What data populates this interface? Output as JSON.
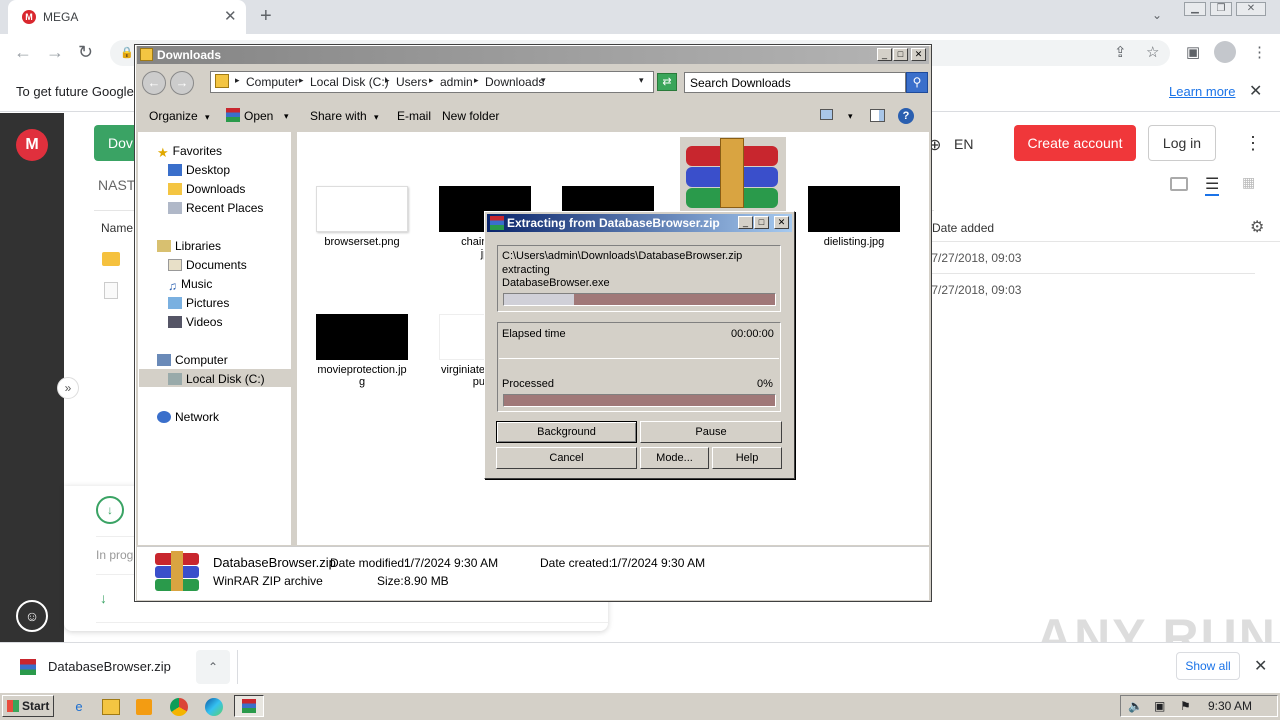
{
  "chrome": {
    "tab_title": "MEGA",
    "tab_favicon": "M",
    "infobar_text": "To get future Google",
    "infobar_link": "Learn more"
  },
  "mega": {
    "green_button": "Dov",
    "breadcrumb": "NAST",
    "name_header": "Name",
    "language": "EN",
    "create_account": "Create account",
    "log_in": "Log in",
    "date_added_header": "Date added",
    "rows": [
      {
        "date": "/7/27/2018, 09:03"
      },
      {
        "date": "/7/27/2018, 09:03"
      }
    ],
    "in_progress": "In prog",
    "watermark": "ANY RUN",
    "accent": "#f0373a",
    "green": "#3aa364"
  },
  "downloads_bar": {
    "filename": "DatabaseBrowser.zip",
    "show_all": "Show all"
  },
  "taskbar": {
    "start": "Start",
    "clock": "9:30 AM"
  },
  "explorer": {
    "title": "Downloads",
    "address": [
      "Computer",
      "Local Disk (C:)",
      "Users",
      "admin",
      "Downloads"
    ],
    "search_placeholder": "Search Downloads",
    "commands": [
      "Organize",
      "Open",
      "Share with",
      "E-mail",
      "New folder"
    ],
    "tree": {
      "favorites": "Favorites",
      "fav_items": [
        "Desktop",
        "Downloads",
        "Recent Places"
      ],
      "libraries": "Libraries",
      "lib_items": [
        "Documents",
        "Music",
        "Pictures",
        "Videos"
      ],
      "computer": "Computer",
      "local_disk": "Local Disk (C:)",
      "network": "Network"
    },
    "files": [
      {
        "name": "browserset.png"
      },
      {
        "name": "chairadmi",
        "name2": "jp"
      },
      {
        "name": "dielisting.jpg"
      },
      {
        "name": "movieprotection.jp",
        "name2": "g"
      },
      {
        "name": "virginiate",
        "name2": "pu"
      }
    ],
    "status": {
      "filename": "DatabaseBrowser.zip",
      "modified_label": "Date modified:",
      "modified": "1/7/2024 9:30 AM",
      "created_label": "Date created:",
      "created": "1/7/2024 9:30 AM",
      "type": "WinRAR ZIP archive",
      "size_label": "Size:",
      "size": "8.90 MB"
    }
  },
  "winrar": {
    "title": "Extracting from DatabaseBrowser.zip",
    "path": "C:\\Users\\admin\\Downloads\\DatabaseBrowser.zip",
    "action": "extracting",
    "file": "DatabaseBrowser.exe",
    "file_progress": 0.26,
    "elapsed_label": "Elapsed time",
    "elapsed": "00:00:00",
    "processed_label": "Processed",
    "processed": "0%",
    "processed_progress": 0,
    "buttons": {
      "background": "Background",
      "pause": "Pause",
      "cancel": "Cancel",
      "mode": "Mode...",
      "help": "Help"
    }
  }
}
